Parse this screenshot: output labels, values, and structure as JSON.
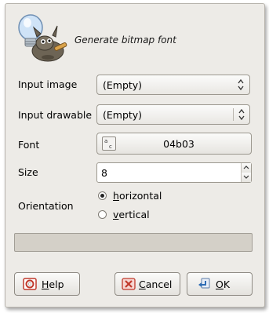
{
  "dialog": {
    "title": "Generate bitmap font",
    "logo_icon": "gimp-script-fu-icon"
  },
  "form": {
    "input_image": {
      "label": "Input image",
      "value": "(Empty)"
    },
    "input_drawable": {
      "label": "Input drawable",
      "value": "(Empty)"
    },
    "font": {
      "label": "Font",
      "value": "04b03",
      "icon": "font-preview-icon",
      "icon_text": "ᵃᴄ"
    },
    "size": {
      "label": "Size",
      "value": "8"
    },
    "orientation": {
      "label": "Orientation",
      "options": [
        {
          "label_first": "h",
          "label_rest": "orizontal",
          "selected": true
        },
        {
          "label_first": "v",
          "label_rest": "ertical",
          "selected": false
        }
      ]
    }
  },
  "progress": {
    "value": 0
  },
  "buttons": {
    "help": {
      "first": "H",
      "rest": "elp",
      "icon": "lifebuoy-icon"
    },
    "cancel": {
      "first": "C",
      "rest": "ancel",
      "icon": "cancel-icon"
    },
    "ok": {
      "first": "O",
      "rest": "K",
      "icon": "ok-arrow-icon"
    }
  },
  "colors": {
    "background": "#edebe7",
    "progress_trough": "#d4d0c8"
  }
}
